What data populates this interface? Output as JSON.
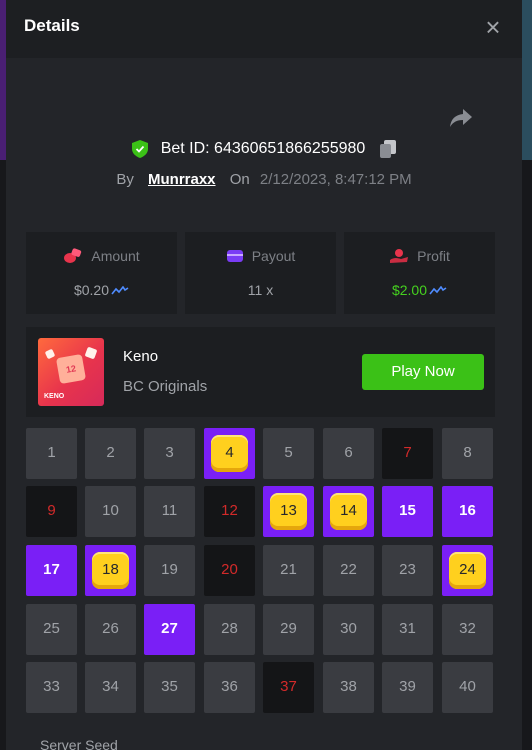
{
  "modal": {
    "title": "Details",
    "close_icon": "close-icon",
    "share_icon": "share-icon"
  },
  "bet": {
    "id_label": "Bet ID: 64360651866255980",
    "by_label": "By",
    "user": "Munrraxx",
    "on_label": "On",
    "datetime": "2/12/2023, 8:47:12 PM"
  },
  "stats": {
    "amount": {
      "label": "Amount",
      "value": "$0.20",
      "icon": "coins-icon",
      "icon_color": "#e8344c"
    },
    "payout": {
      "label": "Payout",
      "value": "11 x",
      "icon": "wallet-icon",
      "icon_color": "#7a3cf5"
    },
    "profit": {
      "label": "Profit",
      "value": "$2.00",
      "icon": "hand-coins-icon",
      "icon_color": "#e8344c",
      "value_color": "#45d11f"
    }
  },
  "game": {
    "thumb_number": "12",
    "thumb_label": "KENO",
    "name": "Keno",
    "provider": "BC Originals",
    "play_label": "Play Now"
  },
  "colors": {
    "accent_purple": "#7a1ff6",
    "accent_green": "#3bc117",
    "gem_yellow": "#ffd01e",
    "miss_red": "#d32a2a"
  },
  "grid": {
    "cells": [
      {
        "n": "1",
        "s": "n"
      },
      {
        "n": "2",
        "s": "n"
      },
      {
        "n": "3",
        "s": "n"
      },
      {
        "n": "4",
        "s": "m"
      },
      {
        "n": "5",
        "s": "n"
      },
      {
        "n": "6",
        "s": "n"
      },
      {
        "n": "7",
        "s": "x"
      },
      {
        "n": "8",
        "s": "n"
      },
      {
        "n": "9",
        "s": "x"
      },
      {
        "n": "10",
        "s": "n"
      },
      {
        "n": "11",
        "s": "n"
      },
      {
        "n": "12",
        "s": "x"
      },
      {
        "n": "13",
        "s": "m"
      },
      {
        "n": "14",
        "s": "m"
      },
      {
        "n": "15",
        "s": "h"
      },
      {
        "n": "16",
        "s": "h"
      },
      {
        "n": "17",
        "s": "h"
      },
      {
        "n": "18",
        "s": "m"
      },
      {
        "n": "19",
        "s": "n"
      },
      {
        "n": "20",
        "s": "x"
      },
      {
        "n": "21",
        "s": "n"
      },
      {
        "n": "22",
        "s": "n"
      },
      {
        "n": "23",
        "s": "n"
      },
      {
        "n": "24",
        "s": "m"
      },
      {
        "n": "25",
        "s": "n"
      },
      {
        "n": "26",
        "s": "n"
      },
      {
        "n": "27",
        "s": "h"
      },
      {
        "n": "28",
        "s": "n"
      },
      {
        "n": "29",
        "s": "n"
      },
      {
        "n": "30",
        "s": "n"
      },
      {
        "n": "31",
        "s": "n"
      },
      {
        "n": "32",
        "s": "n"
      },
      {
        "n": "33",
        "s": "n"
      },
      {
        "n": "34",
        "s": "n"
      },
      {
        "n": "35",
        "s": "n"
      },
      {
        "n": "36",
        "s": "n"
      },
      {
        "n": "37",
        "s": "x"
      },
      {
        "n": "38",
        "s": "n"
      },
      {
        "n": "39",
        "s": "n"
      },
      {
        "n": "40",
        "s": "n"
      }
    ]
  },
  "server_seed_label": "Server Seed"
}
